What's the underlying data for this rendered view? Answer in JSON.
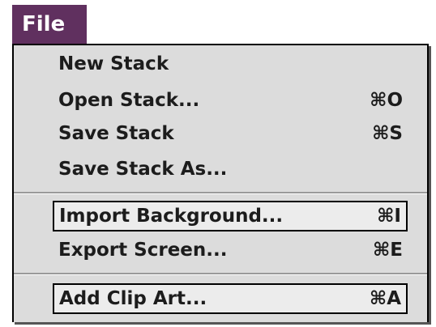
{
  "menu_bar": {
    "title": "File"
  },
  "menu": {
    "items": [
      {
        "label": "New Stack",
        "shortcut": ""
      },
      {
        "label": "Open Stack...",
        "shortcut": "⌘O"
      },
      {
        "label": "Save Stack",
        "shortcut": "⌘S"
      },
      {
        "label": "Save Stack As...",
        "shortcut": ""
      },
      {
        "label": "Import Background...",
        "shortcut": "⌘I"
      },
      {
        "label": "Export Screen...",
        "shortcut": "⌘E"
      },
      {
        "label": "Add Clip Art...",
        "shortcut": "⌘A"
      }
    ]
  },
  "colors": {
    "menu_title_bg": "#60305f",
    "menu_bg": "#dcdcdc"
  }
}
